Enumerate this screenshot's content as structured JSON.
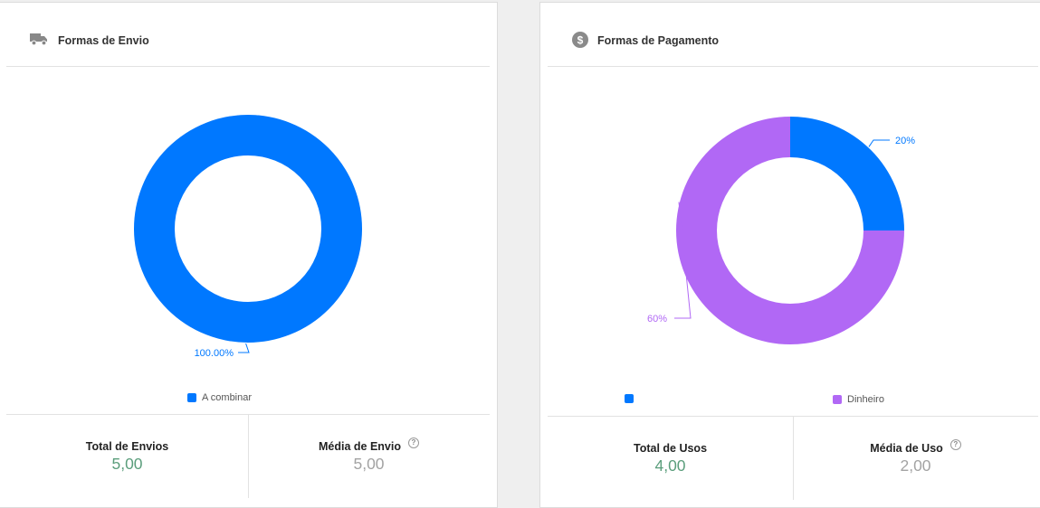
{
  "envio": {
    "title": "Formas de Envio",
    "icon": "truck-icon",
    "chart_data": {
      "type": "pie",
      "donut": true,
      "categories": [
        "A combinar"
      ],
      "values": [
        100
      ],
      "colors": [
        "#0078ff"
      ],
      "labels": [
        "100.00%"
      ]
    },
    "legend": [
      {
        "label": "A combinar",
        "color": "#0078ff"
      }
    ],
    "stats": {
      "total_label": "Total de Envios",
      "total_value": "5,00",
      "media_label": "Média de Envio",
      "media_value": "5,00"
    }
  },
  "pagamento": {
    "title": "Formas de Pagamento",
    "icon": "dollar-icon",
    "chart_data": {
      "type": "pie",
      "donut": true,
      "categories": [
        "",
        "Dinheiro"
      ],
      "values": [
        25,
        75
      ],
      "colors": [
        "#0078ff",
        "#b168f5"
      ],
      "labels": [
        "20%",
        "60%"
      ]
    },
    "legend": [
      {
        "label": "",
        "color": "#0078ff"
      },
      {
        "label": "Dinheiro",
        "color": "#b168f5"
      }
    ],
    "stats": {
      "total_label": "Total de Usos",
      "total_value": "4,00",
      "media_label": "Média de Uso",
      "media_value": "2,00"
    }
  },
  "help_symbol": "?"
}
